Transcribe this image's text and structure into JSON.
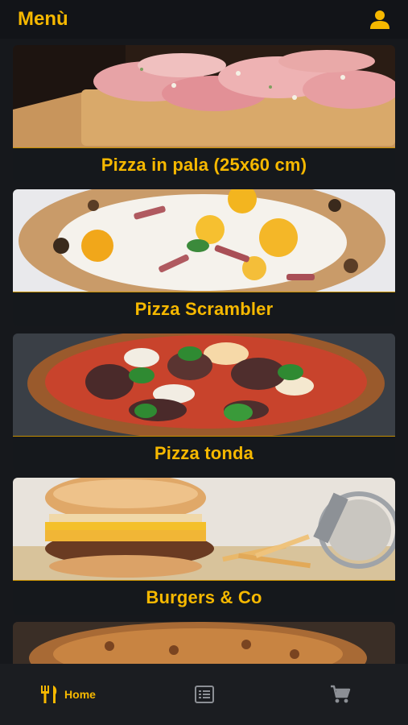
{
  "header": {
    "title": "Menù",
    "user_icon": "user-icon"
  },
  "colors": {
    "accent": "#f6b800",
    "background": "#16181c",
    "nav_inactive": "#8c8f95"
  },
  "categories": [
    {
      "label": "Pizza in pala (25x60 cm)",
      "image": "pizza-in-pala-photo"
    },
    {
      "label": "Pizza Scrambler",
      "image": "pizza-scrambler-photo"
    },
    {
      "label": "Pizza tonda",
      "image": "pizza-tonda-photo"
    },
    {
      "label": "Burgers & Co",
      "image": "burger-fries-photo"
    },
    {
      "label": "",
      "image": "partial-card-photo"
    }
  ],
  "bottom_nav": {
    "items": [
      {
        "label": "Home",
        "icon": "fork-knife-icon",
        "active": true
      },
      {
        "label": "",
        "icon": "list-icon",
        "active": false
      },
      {
        "label": "",
        "icon": "cart-icon",
        "active": false
      }
    ]
  }
}
